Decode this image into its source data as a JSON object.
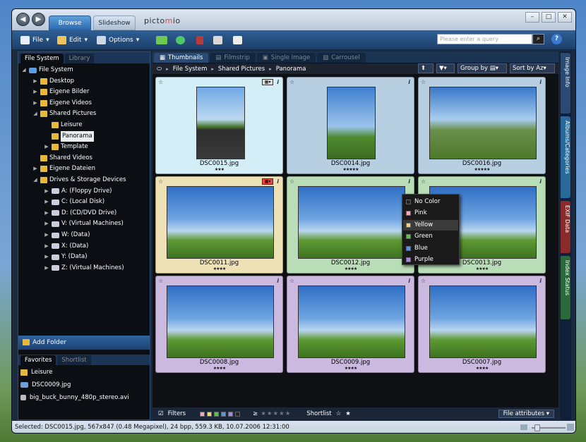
{
  "window": {
    "tabs": [
      {
        "label": "Browse",
        "active": true
      },
      {
        "label": "Slideshow",
        "active": false
      }
    ],
    "logo_pre": "picto",
    "logo_mid": "m",
    "logo_post": "io"
  },
  "toolbar": {
    "file": "File",
    "edit": "Edit",
    "options": "Options",
    "search_placeholder": "Please enter a query",
    "help": "?"
  },
  "left": {
    "tabs": [
      "File System",
      "Library"
    ],
    "tree": [
      {
        "label": "File System",
        "lvl": 0,
        "exp": "open",
        "icon": "pc"
      },
      {
        "label": "Desktop",
        "lvl": 1,
        "exp": "closed",
        "icon": "folder"
      },
      {
        "label": "Eigene Bilder",
        "lvl": 1,
        "exp": "closed",
        "icon": "folder"
      },
      {
        "label": "Eigene Videos",
        "lvl": 1,
        "exp": "closed",
        "icon": "folder"
      },
      {
        "label": "Shared Pictures",
        "lvl": 1,
        "exp": "open",
        "icon": "folder"
      },
      {
        "label": "Leisure",
        "lvl": 2,
        "exp": "none",
        "icon": "folder"
      },
      {
        "label": "Panorama",
        "lvl": 2,
        "exp": "none",
        "icon": "folder",
        "selected": true
      },
      {
        "label": "Template",
        "lvl": 2,
        "exp": "closed",
        "icon": "folder"
      },
      {
        "label": "Shared Videos",
        "lvl": 1,
        "exp": "none",
        "icon": "folder"
      },
      {
        "label": "Eigene Dateien",
        "lvl": 1,
        "exp": "closed",
        "icon": "folder"
      },
      {
        "label": "Drives & Storage Devices",
        "lvl": 1,
        "exp": "open",
        "icon": "folder"
      },
      {
        "label": "A: (Floppy Drive)",
        "lvl": 2,
        "exp": "closed",
        "icon": "drive"
      },
      {
        "label": "C: (Local Disk)",
        "lvl": 2,
        "exp": "closed",
        "icon": "drive"
      },
      {
        "label": "D: (CD/DVD Drive)",
        "lvl": 2,
        "exp": "closed",
        "icon": "drive"
      },
      {
        "label": "V: (Virtual Machines)",
        "lvl": 2,
        "exp": "closed",
        "icon": "drive"
      },
      {
        "label": "W: (Data)",
        "lvl": 2,
        "exp": "closed",
        "icon": "drive"
      },
      {
        "label": "X: (Data)",
        "lvl": 2,
        "exp": "closed",
        "icon": "drive"
      },
      {
        "label": "Y: (Data)",
        "lvl": 2,
        "exp": "closed",
        "icon": "drive"
      },
      {
        "label": "Z: (Virtual Machines)",
        "lvl": 2,
        "exp": "closed",
        "icon": "drive"
      }
    ],
    "add_folder": "Add Folder",
    "fav_tabs": [
      "Favorites",
      "Shortlist"
    ],
    "favorites": [
      {
        "label": "Leisure",
        "icon": "folder"
      },
      {
        "label": "DSC0009.jpg",
        "icon": "image"
      },
      {
        "label": "big_buck_bunny_480p_stereo.avi",
        "icon": "video"
      }
    ]
  },
  "main": {
    "view_tabs": [
      "Thumbnails",
      "Filmstrip",
      "Single Image",
      "Carrousel"
    ],
    "breadcrumb": [
      "File System",
      "Shared Pictures",
      "Panorama"
    ],
    "group_by": "Group by",
    "sort_by": "Sort by",
    "sort_icon": "Az",
    "thumbs": [
      {
        "name": "DSC0015.jpg",
        "stars": "★★★",
        "bg": "#d4eef8",
        "img": "road"
      },
      {
        "name": "DSC0014.jpg",
        "stars": "★★★★★",
        "bg": "#b8cfe2",
        "img": "tree"
      },
      {
        "name": "DSC0016.jpg",
        "stars": "★★★★★",
        "bg": "#b8cfe2",
        "img": "hills"
      },
      {
        "name": "DSC0011.jpg",
        "stars": "★★★★",
        "bg": "#efe1b6",
        "img": "person"
      },
      {
        "name": "DSC0012.jpg",
        "stars": "★★★★",
        "bg": "#b9deb7",
        "img": "person"
      },
      {
        "name": "DSC0013.jpg",
        "stars": "★★★★",
        "bg": "#b9deb7",
        "img": "person"
      },
      {
        "name": "DSC0008.jpg",
        "stars": "★★★★",
        "bg": "#cbb9e0",
        "img": "person"
      },
      {
        "name": "DSC0009.jpg",
        "stars": "★★★★",
        "bg": "#cbb9e0",
        "img": "person"
      },
      {
        "name": "DSC0007.jpg",
        "stars": "★★★★",
        "bg": "#cbb9e0",
        "img": "person"
      }
    ],
    "color_menu": [
      {
        "label": "No Color",
        "color": "#222222"
      },
      {
        "label": "Pink",
        "color": "#f0a8c0"
      },
      {
        "label": "Yellow",
        "color": "#f2d27a",
        "highlight": true
      },
      {
        "label": "Green",
        "color": "#5cbf4e"
      },
      {
        "label": "Blue",
        "color": "#5f93d6"
      },
      {
        "label": "Purple",
        "color": "#a58ad6"
      }
    ],
    "bottom": {
      "filters": "Filters",
      "geq": "≥",
      "rating": "★★★★★",
      "shortlist": "Shortlist",
      "file_attributes": "File attributes"
    }
  },
  "right_tabs": [
    {
      "label": "Image Info",
      "color": "#2a4a72"
    },
    {
      "label": "Albums/Categories",
      "color": "#2a6a9a"
    },
    {
      "label": "EXIF Data",
      "color": "#8a2a2a"
    },
    {
      "label": "Index Status",
      "color": "#2a6a3a"
    }
  ],
  "status": "Selected: DSC0015.jpg, 567x847 (0.48 Megapixel), 24 bpp, 559.3 KB, 10.07.2006 12:31:00"
}
